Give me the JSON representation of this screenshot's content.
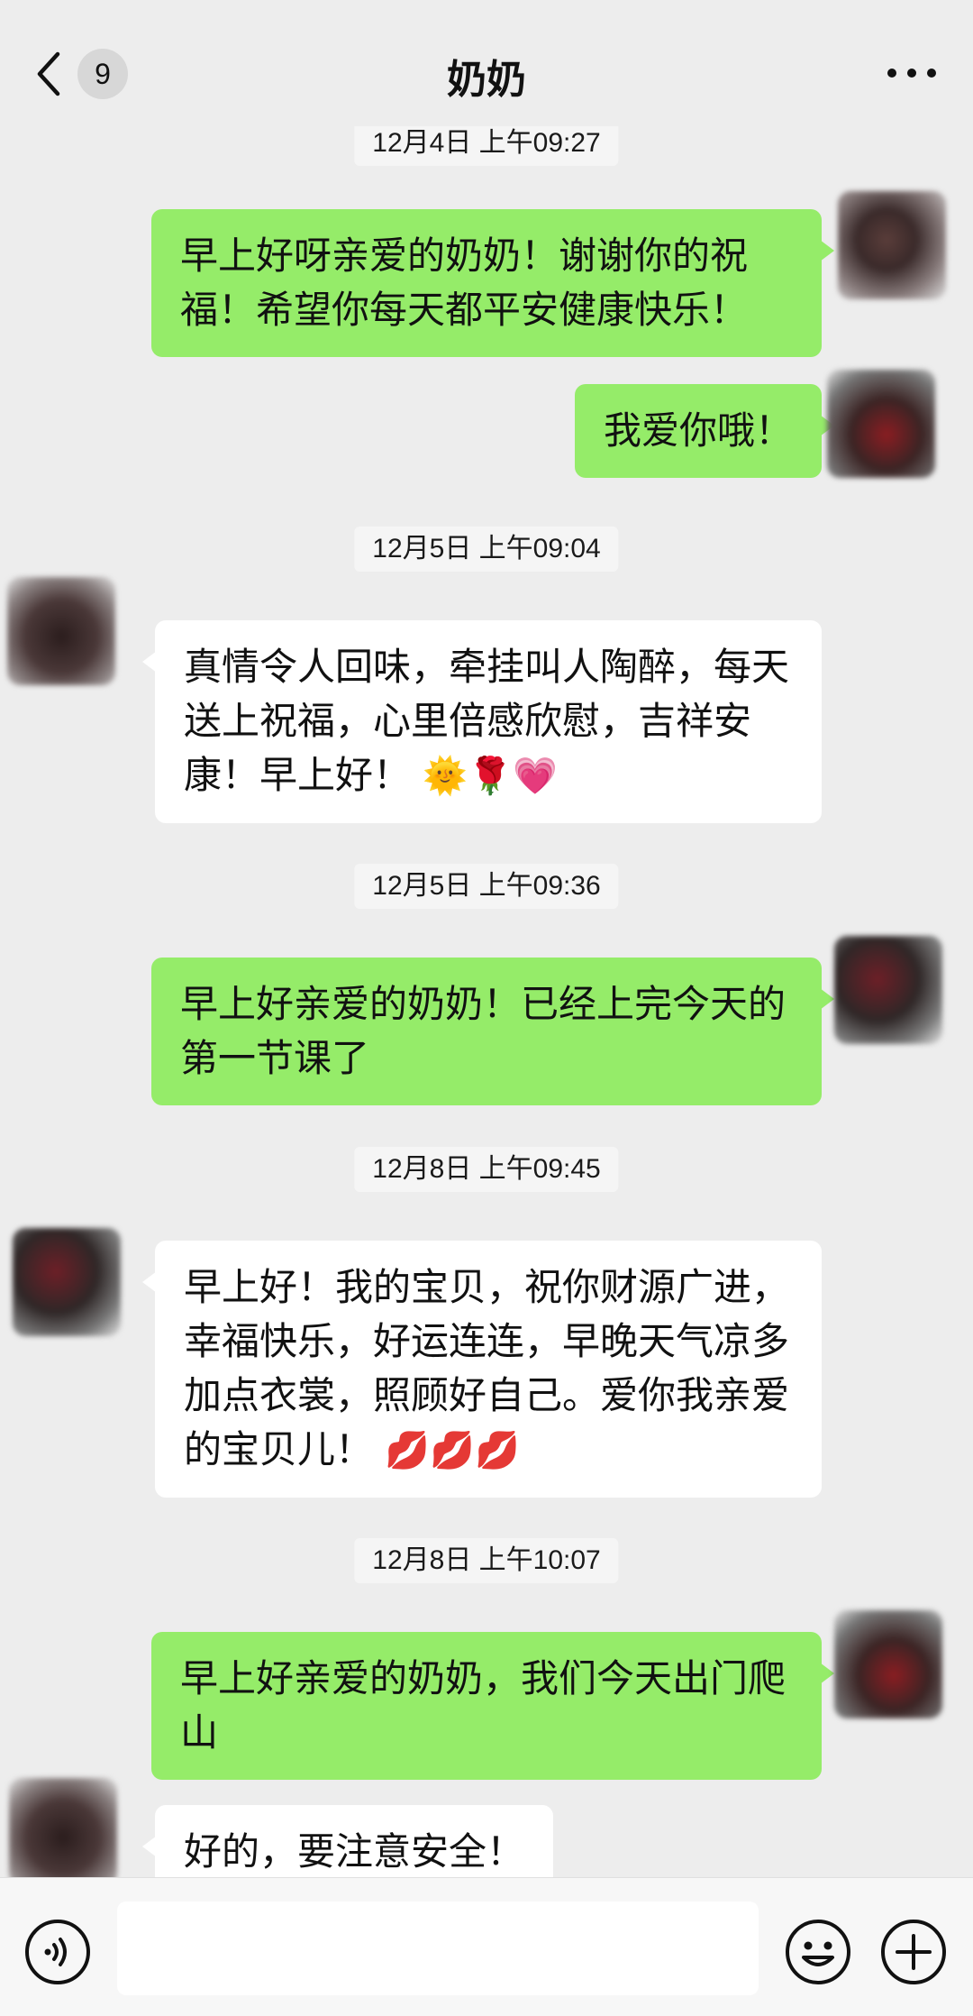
{
  "header": {
    "title": "奶奶",
    "unread_count": "9",
    "back_icon": "chevron-left-icon",
    "more_icon": "more-dots-icon"
  },
  "messages": [
    {
      "type": "timestamp",
      "text": "12月4日 上午09:27"
    },
    {
      "type": "out",
      "text": "早上好呀亲爱的奶奶！谢谢你的祝福！希望你每天都平安健康快乐！"
    },
    {
      "type": "out",
      "text": "我爱你哦！"
    },
    {
      "type": "timestamp",
      "text": "12月5日 上午09:04"
    },
    {
      "type": "in",
      "text": "真情令人回味，牵挂叫人陶醉，每天送上祝福，心里倍感欣慰，吉祥安康！早上好！",
      "emoji": "🌞🌹💗"
    },
    {
      "type": "timestamp",
      "text": "12月5日 上午09:36"
    },
    {
      "type": "out",
      "text": "早上好亲爱的奶奶！已经上完今天的第一节课了"
    },
    {
      "type": "timestamp",
      "text": "12月8日 上午09:45"
    },
    {
      "type": "in",
      "text": "早上好！我的宝贝，祝你财源广进，幸福快乐，好运连连，早晚天气凉多加点衣裳，照顾好自己。爱你我亲爱的宝贝儿！",
      "emoji": "💋💋💋"
    },
    {
      "type": "timestamp",
      "text": "12月8日 上午10:07"
    },
    {
      "type": "out",
      "text": "早上好亲爱的奶奶，我们今天出门爬山"
    },
    {
      "type": "in",
      "text": "好的，要注意安全！"
    }
  ],
  "input_bar": {
    "voice_icon": "voice-icon",
    "emoji_icon": "emoji-face-icon",
    "plus_icon": "plus-circle-icon",
    "text_value": ""
  },
  "colors": {
    "background": "#ededed",
    "outgoing_bubble": "#95ec69",
    "incoming_bubble": "#ffffff"
  }
}
